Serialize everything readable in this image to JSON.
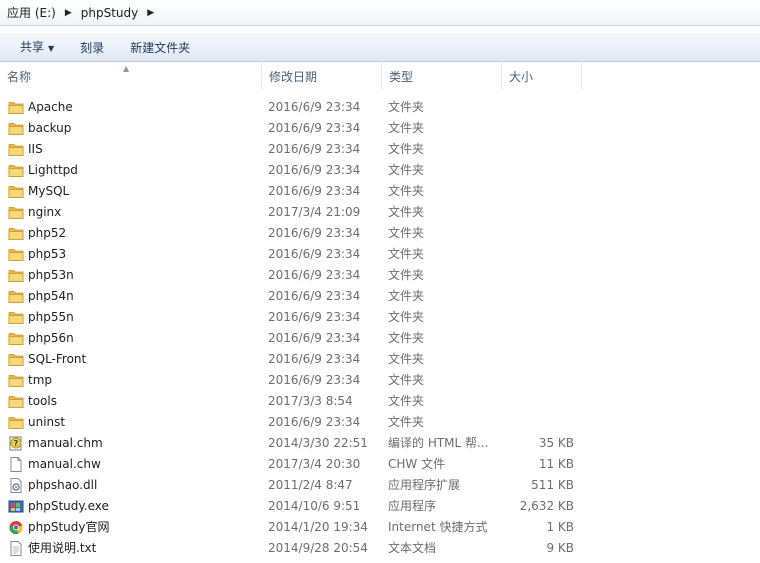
{
  "breadcrumb": [
    "应用 (E:)",
    "phpStudy"
  ],
  "toolbar": {
    "share_label": "共享",
    "burn_label": "刻录",
    "new_folder_label": "新建文件夹"
  },
  "columns": {
    "name": "名称",
    "date": "修改日期",
    "type": "类型",
    "size": "大小"
  },
  "files": [
    {
      "name": "Apache",
      "date": "2016/6/9 23:34",
      "type": "文件夹",
      "size": "",
      "icon": "folder-icon"
    },
    {
      "name": "backup",
      "date": "2016/6/9 23:34",
      "type": "文件夹",
      "size": "",
      "icon": "folder-icon"
    },
    {
      "name": "IIS",
      "date": "2016/6/9 23:34",
      "type": "文件夹",
      "size": "",
      "icon": "folder-icon"
    },
    {
      "name": "Lighttpd",
      "date": "2016/6/9 23:34",
      "type": "文件夹",
      "size": "",
      "icon": "folder-icon"
    },
    {
      "name": "MySQL",
      "date": "2016/6/9 23:34",
      "type": "文件夹",
      "size": "",
      "icon": "folder-icon"
    },
    {
      "name": "nginx",
      "date": "2017/3/4 21:09",
      "type": "文件夹",
      "size": "",
      "icon": "folder-icon"
    },
    {
      "name": "php52",
      "date": "2016/6/9 23:34",
      "type": "文件夹",
      "size": "",
      "icon": "folder-icon"
    },
    {
      "name": "php53",
      "date": "2016/6/9 23:34",
      "type": "文件夹",
      "size": "",
      "icon": "folder-icon"
    },
    {
      "name": "php53n",
      "date": "2016/6/9 23:34",
      "type": "文件夹",
      "size": "",
      "icon": "folder-icon"
    },
    {
      "name": "php54n",
      "date": "2016/6/9 23:34",
      "type": "文件夹",
      "size": "",
      "icon": "folder-icon"
    },
    {
      "name": "php55n",
      "date": "2016/6/9 23:34",
      "type": "文件夹",
      "size": "",
      "icon": "folder-icon"
    },
    {
      "name": "php56n",
      "date": "2016/6/9 23:34",
      "type": "文件夹",
      "size": "",
      "icon": "folder-icon"
    },
    {
      "name": "SQL-Front",
      "date": "2016/6/9 23:34",
      "type": "文件夹",
      "size": "",
      "icon": "folder-icon"
    },
    {
      "name": "tmp",
      "date": "2016/6/9 23:34",
      "type": "文件夹",
      "size": "",
      "icon": "folder-icon"
    },
    {
      "name": "tools",
      "date": "2017/3/3 8:54",
      "type": "文件夹",
      "size": "",
      "icon": "folder-icon"
    },
    {
      "name": "uninst",
      "date": "2016/6/9 23:34",
      "type": "文件夹",
      "size": "",
      "icon": "folder-icon"
    },
    {
      "name": "manual.chm",
      "date": "2014/3/30 22:51",
      "type": "编译的 HTML 帮...",
      "size": "35 KB",
      "icon": "help-file-icon"
    },
    {
      "name": "manual.chw",
      "date": "2017/3/4 20:30",
      "type": "CHW 文件",
      "size": "11 KB",
      "icon": "blank-file-icon"
    },
    {
      "name": "phpshao.dll",
      "date": "2011/2/4 8:47",
      "type": "应用程序扩展",
      "size": "511 KB",
      "icon": "dll-file-icon"
    },
    {
      "name": "phpStudy.exe",
      "date": "2014/10/6 9:51",
      "type": "应用程序",
      "size": "2,632 KB",
      "icon": "exe-app-icon"
    },
    {
      "name": "phpStudy官网",
      "date": "2014/1/20 19:34",
      "type": "Internet 快捷方式",
      "size": "1 KB",
      "icon": "chrome-shortcut-icon"
    },
    {
      "name": "使用说明.txt",
      "date": "2014/9/28 20:54",
      "type": "文本文档",
      "size": "9 KB",
      "icon": "text-file-icon"
    }
  ]
}
